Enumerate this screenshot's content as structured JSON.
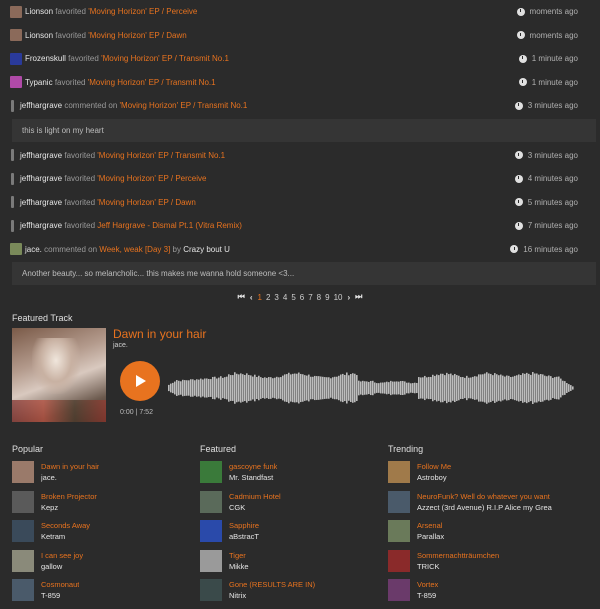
{
  "feed": [
    {
      "user": "Lionson",
      "action": "favorited",
      "target": "'Moving Horizon' EP / Perceive",
      "time": "moments ago",
      "avatar": "#8b6a5a"
    },
    {
      "user": "Lionson",
      "action": "favorited",
      "target": "'Moving Horizon' EP / Dawn",
      "time": "moments ago",
      "avatar": "#8b6a5a"
    },
    {
      "user": "Frozenskull",
      "action": "favorited",
      "target": "'Moving Horizon' EP / Transmit No.1",
      "time": "1 minute ago",
      "avatar": "#2a3a9a"
    },
    {
      "user": "Typanic",
      "action": "favorited",
      "target": "'Moving Horizon' EP / Transmit No.1",
      "time": "1 minute ago",
      "avatar": "#b04aa8"
    },
    {
      "user": "jeffhargrave",
      "action": "commented on",
      "target": "'Moving Horizon' EP / Transmit No.1",
      "time": "3 minutes ago",
      "avatar": "thin"
    },
    {
      "comment": "this is light on my heart"
    },
    {
      "user": "jeffhargrave",
      "action": "favorited",
      "target": "'Moving Horizon' EP / Transmit No.1",
      "time": "3 minutes ago",
      "avatar": "thin"
    },
    {
      "user": "jeffhargrave",
      "action": "favorited",
      "target": "'Moving Horizon' EP / Perceive",
      "time": "4 minutes ago",
      "avatar": "thin"
    },
    {
      "user": "jeffhargrave",
      "action": "favorited",
      "target": "'Moving Horizon' EP / Dawn",
      "time": "5 minutes ago",
      "avatar": "thin"
    },
    {
      "user": "jeffhargrave",
      "action": "favorited",
      "target": "Jeff Hargrave - Dismal Pt.1 (Vitra Remix)",
      "time": "7 minutes ago",
      "avatar": "thin"
    },
    {
      "user": "jace.",
      "action": "commented on",
      "target": "Week, weak [Day 3]",
      "extra_by": "by",
      "extra_user": "Crazy bout U",
      "time": "16 minutes ago",
      "avatar": "#7a8a5a"
    },
    {
      "comment": "Another beauty... so melancholic... this makes me wanna hold someone <3..."
    }
  ],
  "pager": {
    "first": "⏮",
    "prev": "‹",
    "pages": [
      "1",
      "2",
      "3",
      "4",
      "5",
      "6",
      "7",
      "8",
      "9",
      "10"
    ],
    "current": "1",
    "next": "›",
    "last": "⏭"
  },
  "featured": {
    "heading": "Featured Track",
    "title": "Dawn in your hair",
    "artist": "jace.",
    "time": "0:00 | 7:52",
    "progress": 0
  },
  "columns": [
    {
      "heading": "Popular",
      "items": [
        {
          "title": "Dawn in your hair",
          "artist": "jace.",
          "thumb": "#9a7a6a"
        },
        {
          "title": "Broken Projector",
          "artist": "Kepz",
          "thumb": "#5a5a5a"
        },
        {
          "title": "Seconds Away",
          "artist": "Ketram",
          "thumb": "#3a4a5a"
        },
        {
          "title": "I can see joy",
          "artist": "gallow",
          "thumb": "#8a8a7a"
        },
        {
          "title": "Cosmonaut",
          "artist": "T-859",
          "thumb": "#4a5a6a"
        }
      ]
    },
    {
      "heading": "Featured",
      "items": [
        {
          "title": "gascoyne funk",
          "artist": "Mr. Standfast",
          "thumb": "#3a7a3a"
        },
        {
          "title": "Cadmium Hotel",
          "artist": "CGK",
          "thumb": "#5a6a5a"
        },
        {
          "title": "Sapphire",
          "artist": "aBstracT",
          "thumb": "#2a4aaa"
        },
        {
          "title": "Tiger",
          "artist": "Mikke",
          "thumb": "#9a9a9a"
        },
        {
          "title": "Gone (RESULTS ARE IN)",
          "artist": "Nitrix",
          "thumb": "#3a4a4a"
        }
      ]
    },
    {
      "heading": "Trending",
      "items": [
        {
          "title": "Follow Me",
          "artist": "Astroboy",
          "thumb": "#a07a4a"
        },
        {
          "title": "NeuroFunk? Well do whatever you want",
          "artist": "Azzect (3rd Avenue) R.I.P Alice my Grea",
          "thumb": "#4a5a6a"
        },
        {
          "title": "Arsenal",
          "artist": "Parallax",
          "thumb": "#6a7a5a"
        },
        {
          "title": "Sommernachtträumchen",
          "artist": "TRICK",
          "thumb": "#8a2a2a"
        },
        {
          "title": "Vortex",
          "artist": "T-859",
          "thumb": "#6a3a6a"
        }
      ]
    }
  ]
}
